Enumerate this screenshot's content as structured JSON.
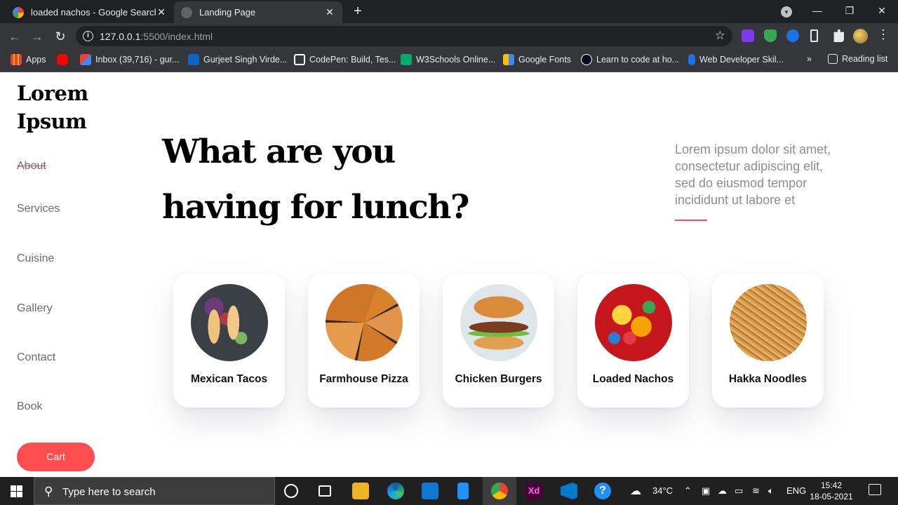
{
  "browser": {
    "tabs": [
      {
        "title": "loaded nachos - Google Search",
        "active": false
      },
      {
        "title": "Landing Page",
        "active": true
      }
    ],
    "new_tab": "+",
    "window_controls": {
      "minimize": "—",
      "restore": "❐",
      "close": "✕"
    },
    "address": {
      "host": "127.0.0.1",
      "rest": ":5500/index.html"
    },
    "bookmarks": [
      {
        "label": "Apps",
        "icon": "apps-grid-icon",
        "color": "#ea4335"
      },
      {
        "label": "",
        "icon": "youtube-icon",
        "color": "#ff0000"
      },
      {
        "label": "Inbox (39,716) - gur...",
        "icon": "gmail-icon",
        "color": "#d93025"
      },
      {
        "label": "Gurjeet Singh Virde...",
        "icon": "linkedin-icon",
        "color": "#0a66c2"
      },
      {
        "label": "CodePen: Build, Tes...",
        "icon": "codepen-icon",
        "color": "#ffffff"
      },
      {
        "label": "W3Schools Online...",
        "icon": "w3schools-icon",
        "color": "#04aa6d"
      },
      {
        "label": "Google Fonts",
        "icon": "google-fonts-icon",
        "color": "#fbbc04"
      },
      {
        "label": "Learn to code at ho...",
        "icon": "freecodecamp-icon",
        "color": "#0a0a23"
      },
      {
        "label": "Web Developer Skil...",
        "icon": "skill-icon",
        "color": "#1a73e8"
      }
    ],
    "bookmarks_overflow": "»",
    "reading_list": "Reading list"
  },
  "site": {
    "logo_line1": "Lorem",
    "logo_line2": "Ipsum",
    "nav": [
      {
        "label": "About",
        "strike": true
      },
      {
        "label": "Services"
      },
      {
        "label": "Cuisine"
      },
      {
        "label": "Gallery"
      },
      {
        "label": "Contact"
      },
      {
        "label": "Book"
      }
    ],
    "cart_label": "Cart",
    "headline_line1": "What are you",
    "headline_line2": "having for lunch?",
    "lede": "Lorem ipsum dolor sit amet, consectetur adipiscing elit, sed do eiusmod tempor incididunt ut labore et",
    "accent": "#ff4e50",
    "dishes": [
      {
        "name": "Mexican Tacos",
        "image": "tacos"
      },
      {
        "name": "Farmhouse Pizza",
        "image": "pizza"
      },
      {
        "name": "Chicken Burgers",
        "image": "burger"
      },
      {
        "name": "Loaded Nachos",
        "image": "nachos"
      },
      {
        "name": "Hakka Noodles",
        "image": "noodles"
      }
    ]
  },
  "taskbar": {
    "search_placeholder": "Type here to search",
    "weather": "34°C",
    "language": "ENG",
    "time": "15:42",
    "date": "18-05-2021"
  }
}
